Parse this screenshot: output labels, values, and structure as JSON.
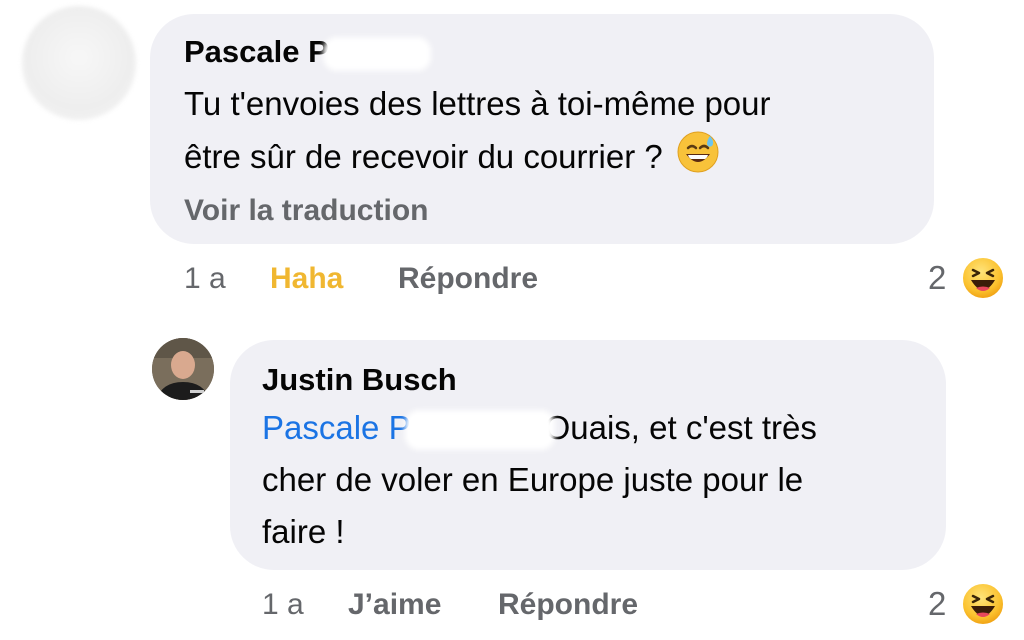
{
  "comment1": {
    "author": "Pascale P",
    "text_line1": "Tu t'envoies des lettres à toi-même pour",
    "text_line2": "être sûr de recevoir du courrier ?",
    "emoji": "sweat-smile-emoji",
    "see_translation": "Voir la traduction",
    "time": "1 a",
    "reaction_label": "Haha",
    "reply_label": "Répondre",
    "reaction_count": "2",
    "reaction_icon": "haha-reaction-icon",
    "reaction_color": "#f0b731"
  },
  "comment2": {
    "author": "Justin Busch",
    "mention": "Pascale P",
    "text_line1_rest": "Ouais, et c'est très",
    "text_line2": "cher de voler en Europe juste pour le",
    "text_line3": "faire !",
    "time": "1 a",
    "like_label": "J’aime",
    "reply_label": "Répondre",
    "reaction_count": "2",
    "reaction_icon": "haha-reaction-icon",
    "mention_color": "#1b74e4"
  }
}
